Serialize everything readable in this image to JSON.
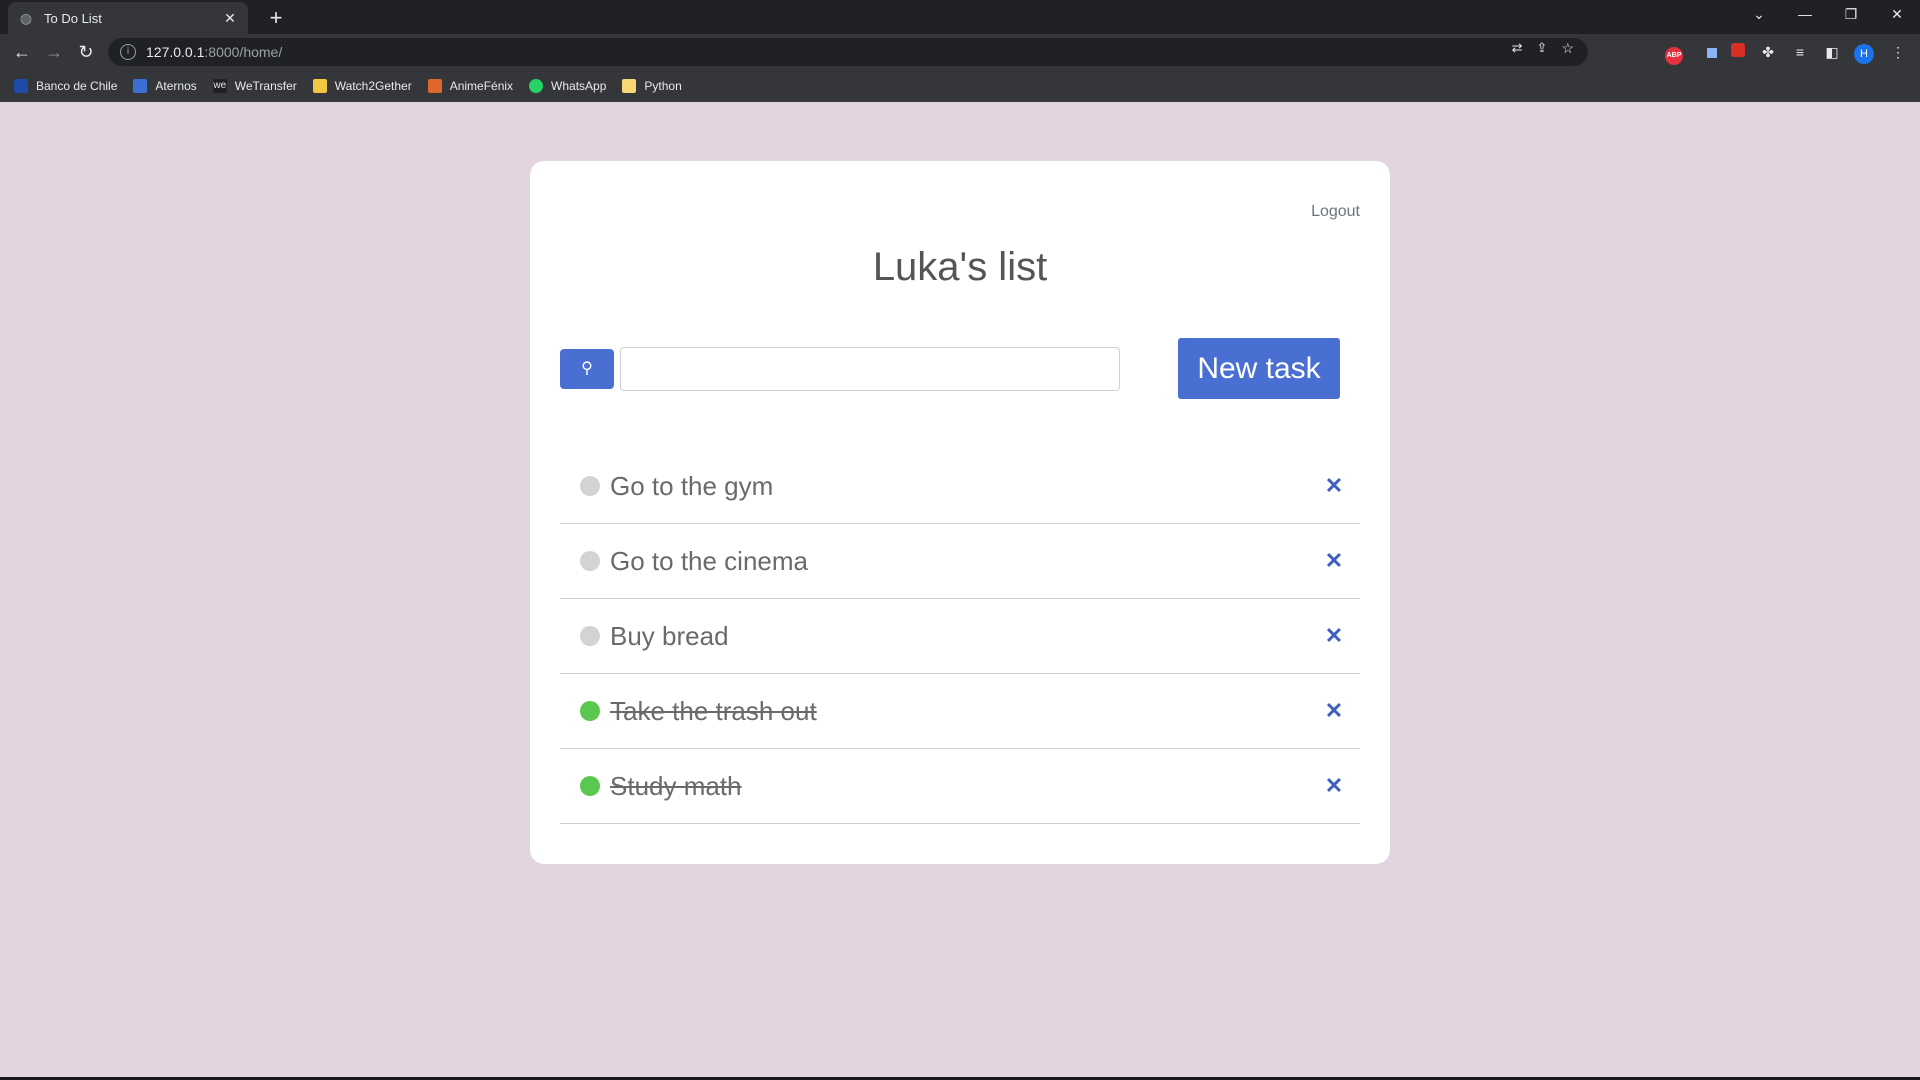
{
  "browser": {
    "tab_title": "To Do List",
    "new_tab_symbol": "+",
    "url_host": "127.0.0.1",
    "url_rest": ":8000/home/",
    "profile_initial": "H"
  },
  "bookmarks": [
    {
      "label": "Banco de Chile",
      "icon": "bank-icon",
      "color": "#1f4aa8"
    },
    {
      "label": "Aternos",
      "icon": "aternos-icon",
      "color": "#3b6fd1"
    },
    {
      "label": "WeTransfer",
      "icon": "wetransfer-icon",
      "color": "#202124"
    },
    {
      "label": "Watch2Gether",
      "icon": "watch2gether-icon",
      "color": "#f2c744"
    },
    {
      "label": "AnimeFénix",
      "icon": "animefenix-icon",
      "color": "#e0662b"
    },
    {
      "label": "WhatsApp",
      "icon": "whatsapp-icon",
      "color": "#25d366"
    },
    {
      "label": "Python",
      "icon": "folder-icon",
      "color": "#f7d774"
    }
  ],
  "page": {
    "logout": "Logout",
    "title": "Luka's list",
    "search_placeholder": "",
    "new_task": "New task"
  },
  "tasks": [
    {
      "label": "Go to the gym",
      "done": false
    },
    {
      "label": "Go to the cinema",
      "done": false
    },
    {
      "label": "Buy bread",
      "done": false
    },
    {
      "label": "Take the trash out",
      "done": true
    },
    {
      "label": "Study math",
      "done": true
    }
  ],
  "colors": {
    "accent": "#4a6fd3",
    "done": "#5ac850",
    "pending": "#d3d3d3",
    "background": "#e2d5df"
  }
}
